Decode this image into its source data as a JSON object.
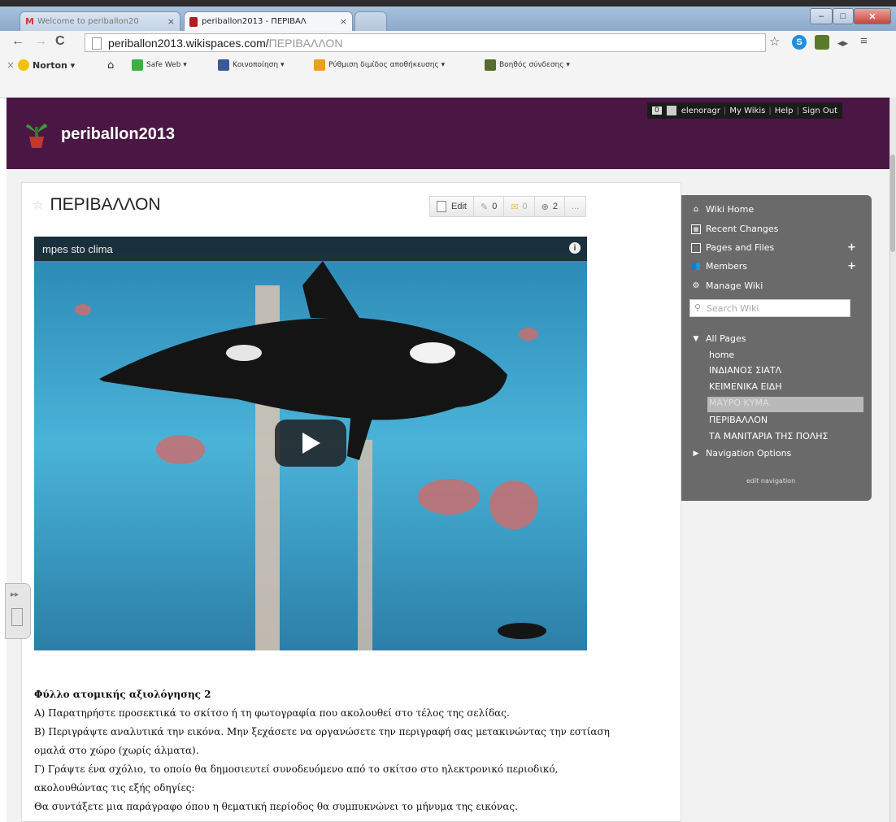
{
  "browser": {
    "tabs": [
      {
        "title": "Welcome to periballon20"
      },
      {
        "title": "periballon2013 - ΠΕΡΙΒΑΛ"
      }
    ],
    "url_host": "periballon2013.wikispaces.com/",
    "url_path": "ΠΕΡΙΒΑΛΛΟΝ",
    "extensions": [
      {
        "letter": "S",
        "color": "#1f8fe0"
      },
      {
        "letter": "",
        "color": "#5a7a2a"
      }
    ]
  },
  "bookmarks": [
    {
      "label": "Norton",
      "color": "#f2c200"
    },
    {
      "label": "Safe Web",
      "color": "#3cb043"
    },
    {
      "label": "Κοινοποίηση",
      "color": "#3b5998"
    },
    {
      "label": "Ρύθμιση διμίδος αποθήκευσης",
      "color": "#e8a020"
    },
    {
      "label": "Βοηθός σύνδεσης",
      "color": "#556b2f"
    }
  ],
  "site": {
    "title": "periballon2013",
    "user_count": "0",
    "username": "elenoragr",
    "links": [
      "My Wikis",
      "Help",
      "Sign Out"
    ]
  },
  "page": {
    "title": "ΠΕΡΙΒΑΛΛΟΝ",
    "edit_label": "Edit",
    "comments_count": "0",
    "favorites_count": "0",
    "followers_count": "2",
    "more_label": "..."
  },
  "video": {
    "title": "mpes sto clima"
  },
  "article": {
    "heading": "Φύλλο ατομικής αξιολόγησης 2",
    "lines": [
      "Α) Παρατηρήστε προσεκτικά το σκίτσο ή τη φωτογραφία που ακολουθεί στο τέλος της σελίδας.",
      "Β) Περιγράψτε αναλυτικά την εικόνα. Μην ξεχάσετε να οργανώσετε την περιγραφή σας μετακινώντας την εστίαση",
      "ομαλά στο χώρο (χωρίς άλματα).",
      "Γ) Γράψτε ένα σχόλιο, το οποίο θα δημοσιευτεί συνοδευόμενο από το σκίτσο στο ηλεκτρονικό περιοδικό,",
      "ακολουθώντας τις εξής οδηγίες:",
      "Θα συντάξετε μια παράγραφο όπου η θεματική περίοδος θα συμπυκνώνει το μήνυμα της εικόνας."
    ]
  },
  "sidebar": {
    "nav": [
      {
        "label": "Wiki Home",
        "icon": "home-icon"
      },
      {
        "label": "Recent Changes",
        "icon": "calendar-icon"
      },
      {
        "label": "Pages and Files",
        "icon": "folder-icon"
      },
      {
        "label": "Members",
        "icon": "members-icon"
      },
      {
        "label": "Manage Wiki",
        "icon": "gear-icon"
      }
    ],
    "search_placeholder": "Search Wiki",
    "all_pages_label": "All Pages",
    "pages": [
      "home",
      "ΙΝΔΙΑΝΟΣ ΣΙΑΤΛ",
      "ΚΕΙΜΕΝΙΚΑ ΕΙΔΗ",
      "ΜΑΥΡΟ ΚΥΜΑ",
      "ΠΕΡΙΒΑΛΛΟΝ",
      "ΤΑ ΜΑΝΙΤΑΡΙΑ ΤΗΣ ΠΟΛΗΣ"
    ],
    "highlighted_page": "ΜΑΥΡΟ ΚΥΜΑ",
    "navigation_options_label": "Navigation Options",
    "edit_navigation_label": "edit navigation"
  }
}
